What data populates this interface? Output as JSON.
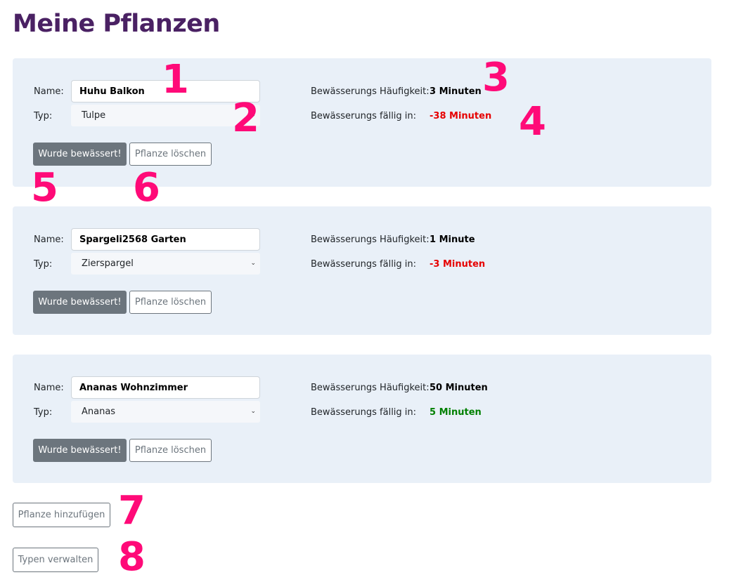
{
  "page": {
    "title": "Meine Pflanzen"
  },
  "labels": {
    "name": "Name:",
    "type": "Typ:",
    "frequency": "Bewässerungs Häufigkeit:",
    "due": "Bewässerungs fällig in:"
  },
  "plants": [
    {
      "name": "Huhu Balkon",
      "type": "Tulpe",
      "frequency": "3 Minuten",
      "due": "-38 Minuten",
      "due_color": "#e60000",
      "water_button": "Wurde bewässert!",
      "delete_button": "Pflanze löschen"
    },
    {
      "name": "Spargeli2568 Garten",
      "type": "Zierspargel",
      "frequency": "1 Minute",
      "due": "-3 Minuten",
      "due_color": "#e60000",
      "water_button": "Wurde bewässert!",
      "delete_button": "Pflanze löschen"
    },
    {
      "name": "Ananas Wohnzimmer",
      "type": "Ananas",
      "frequency": "50 Minuten",
      "due": "5 Minuten",
      "due_color": "#008000",
      "water_button": "Wurde bewässert!",
      "delete_button": "Pflanze löschen"
    }
  ],
  "actions": {
    "add_plant": "Pflanze hinzufügen",
    "manage_types": "Typen verwalten"
  },
  "annotations": [
    "1",
    "2",
    "3",
    "4",
    "5",
    "6",
    "7",
    "8"
  ],
  "colors": {
    "title": "#4a2163",
    "card_bg": "#e9f0f8",
    "annotation": "#ff0a78",
    "overdue": "#e60000",
    "ok": "#008000",
    "button_grey": "#6c757d"
  }
}
